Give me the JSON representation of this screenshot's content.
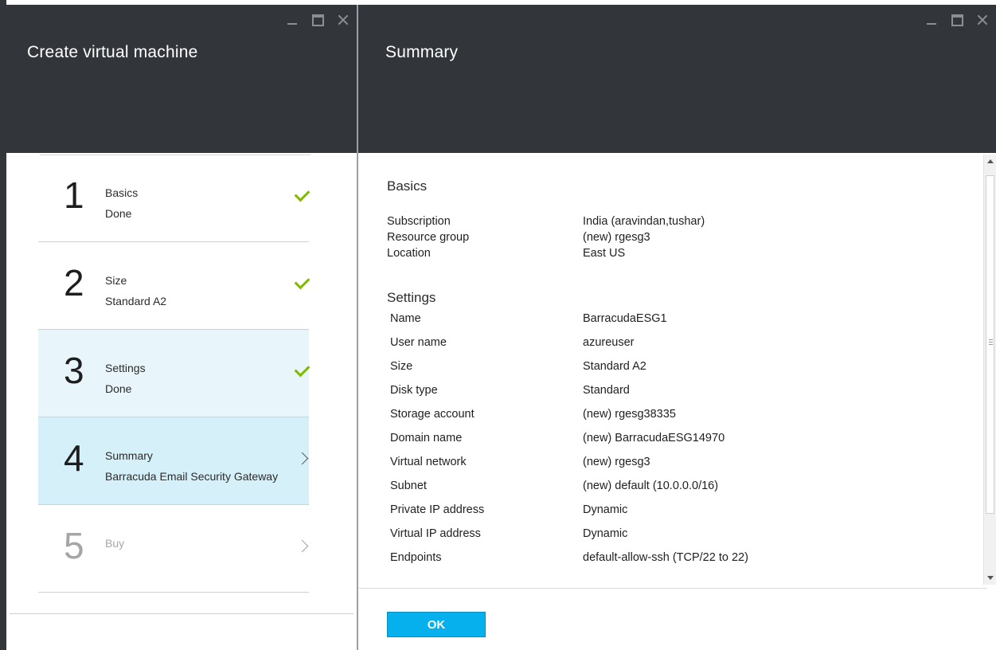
{
  "left_blade": {
    "title": "Create virtual machine",
    "steps": [
      {
        "number": "1",
        "title": "Basics",
        "subtitle": "Done",
        "status": "done"
      },
      {
        "number": "2",
        "title": "Size",
        "subtitle": "Standard A2",
        "status": "done"
      },
      {
        "number": "3",
        "title": "Settings",
        "subtitle": "Done",
        "status": "done"
      },
      {
        "number": "4",
        "title": "Summary",
        "subtitle": "Barracuda Email Security Gateway",
        "status": "current"
      },
      {
        "number": "5",
        "title": "Buy",
        "subtitle": "",
        "status": "disabled"
      }
    ]
  },
  "right_blade": {
    "title": "Summary",
    "sections": {
      "basics": {
        "heading": "Basics",
        "rows": [
          {
            "label": "Subscription",
            "value": "India (aravindan,tushar)"
          },
          {
            "label": "Resource group",
            "value": "(new) rgesg3"
          },
          {
            "label": "Location",
            "value": "East US"
          }
        ]
      },
      "settings": {
        "heading": "Settings",
        "rows": [
          {
            "label": "Name",
            "value": "BarracudaESG1"
          },
          {
            "label": "User name",
            "value": "azureuser"
          },
          {
            "label": "Size",
            "value": "Standard A2"
          },
          {
            "label": "Disk type",
            "value": "Standard"
          },
          {
            "label": "Storage account",
            "value": "(new) rgesg38335"
          },
          {
            "label": "Domain name",
            "value": "(new) BarracudaESG14970"
          },
          {
            "label": "Virtual network",
            "value": "(new) rgesg3"
          },
          {
            "label": "Subnet",
            "value": "(new) default (10.0.0.0/16)"
          },
          {
            "label": "Private IP address",
            "value": "Dynamic"
          },
          {
            "label": "Virtual IP address",
            "value": "Dynamic"
          },
          {
            "label": "Endpoints",
            "value": "default-allow-ssh (TCP/22 to 22)"
          }
        ]
      }
    },
    "ok_label": "OK"
  },
  "colors": {
    "header_bg": "#32363b",
    "check_green": "#7fba00",
    "ok_blue": "#05b0ec",
    "active_step_bg": "#d5f0f8",
    "done_step_bg": "#e8f6fb"
  },
  "icons": [
    "minimize-icon",
    "maximize-icon",
    "close-icon",
    "checkmark-icon",
    "chevron-right-icon"
  ]
}
